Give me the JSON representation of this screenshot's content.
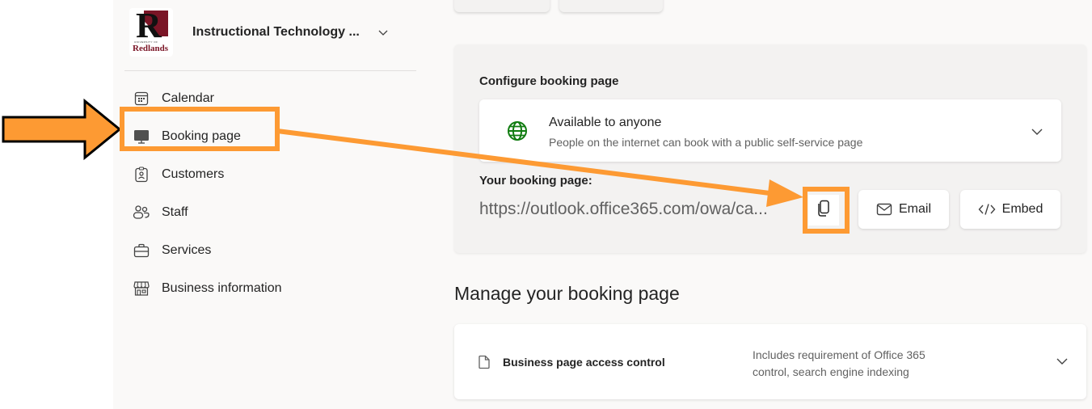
{
  "sidebar": {
    "business": {
      "logo_univ_text": "UNIVERSITY OF",
      "logo_name_text": "Redlands",
      "logo_letter": "R",
      "name": "Instructional Technology ..."
    },
    "items": [
      {
        "label": "Calendar",
        "icon": "calendar-icon"
      },
      {
        "label": "Booking page",
        "icon": "monitor-icon",
        "selected": true
      },
      {
        "label": "Customers",
        "icon": "contact-card-icon"
      },
      {
        "label": "Staff",
        "icon": "people-icon"
      },
      {
        "label": "Services",
        "icon": "briefcase-icon"
      },
      {
        "label": "Business information",
        "icon": "storefront-icon"
      }
    ]
  },
  "configure": {
    "title": "Configure booking page",
    "availability": {
      "title": "Available to anyone",
      "subtitle": "People on the internet can book with a public self-service page"
    },
    "your_booking_page_label": "Your booking page:",
    "url": "https://outlook.office365.com/owa/ca...",
    "email_label": "Email",
    "embed_label": "Embed"
  },
  "manage": {
    "title": "Manage your booking page",
    "access_control": {
      "title": "Business page access control",
      "description_line1": "Includes requirement of Office 365",
      "description_line2": "control, search engine indexing"
    }
  },
  "colors": {
    "annotation_orange": "#fd9a33",
    "globe_green": "#107c10",
    "logo_maroon": "#7a1526",
    "background": "#faf9f8",
    "card_gray": "#f3f2f1"
  }
}
